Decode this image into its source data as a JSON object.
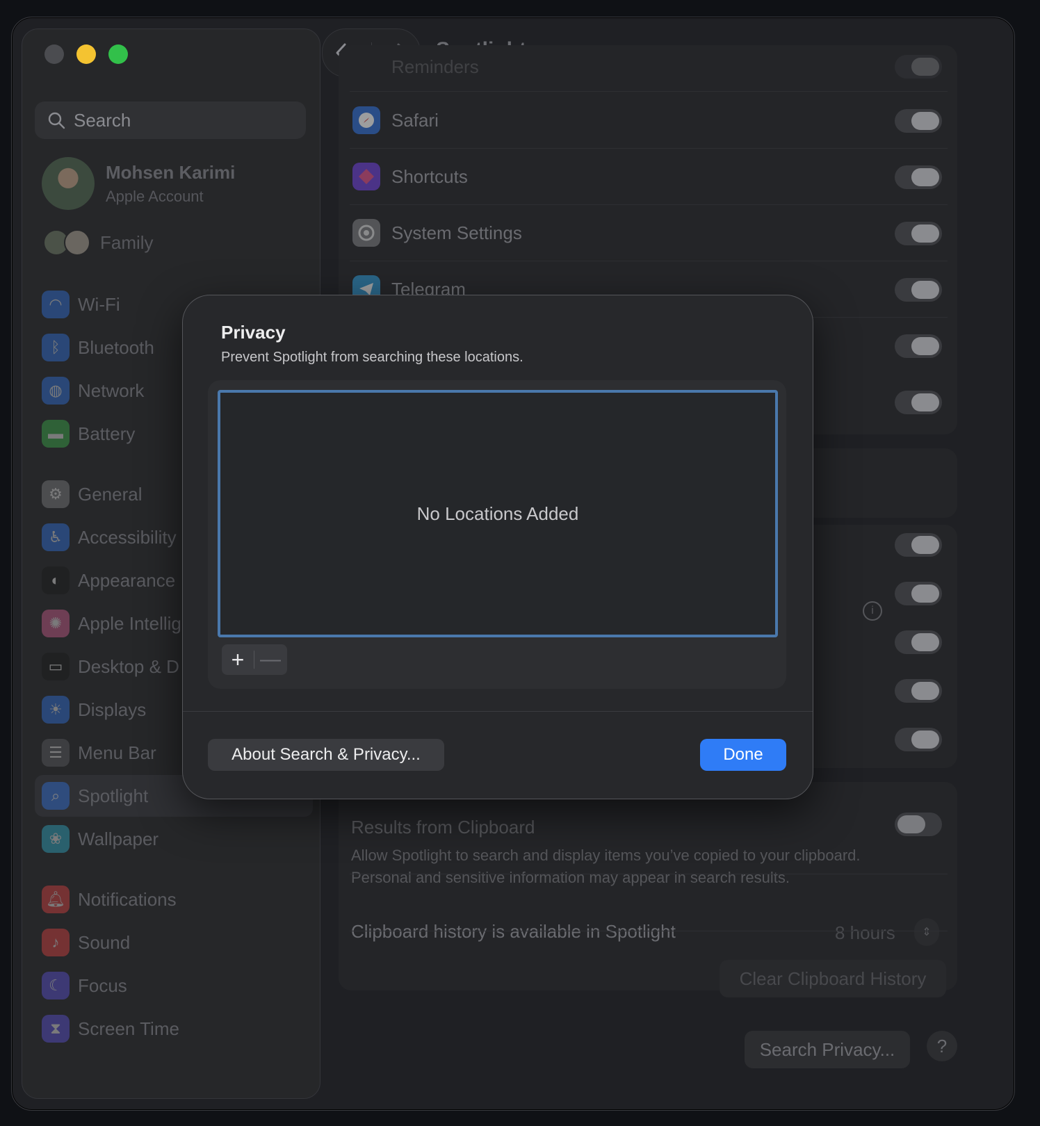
{
  "window": {
    "title": "Spotlight"
  },
  "sidebar": {
    "search_placeholder": "Search",
    "account": {
      "name": "Mohsen Karimi",
      "subtitle": "Apple Account"
    },
    "family_label": "Family",
    "items": [
      {
        "label": "Wi-Fi",
        "icon": "wifi-icon",
        "color": "#2f6fd6"
      },
      {
        "label": "Bluetooth",
        "icon": "bluetooth-icon",
        "color": "#2f6fd6"
      },
      {
        "label": "Network",
        "icon": "globe-icon",
        "color": "#2f6fd6"
      },
      {
        "label": "Battery",
        "icon": "battery-icon",
        "color": "#3aa84a"
      },
      {
        "label": "General",
        "icon": "gear-icon",
        "color": "#7a7b7f"
      },
      {
        "label": "Accessibility",
        "icon": "accessibility-icon",
        "color": "#2f6fd6"
      },
      {
        "label": "Appearance",
        "icon": "appearance-icon",
        "color": "#1a1a1a"
      },
      {
        "label": "Apple Intellig",
        "icon": "apple-intelligence-icon",
        "color": "#c65a8a"
      },
      {
        "label": "Desktop & D",
        "icon": "desktop-dock-icon",
        "color": "#1a1a1a"
      },
      {
        "label": "Displays",
        "icon": "displays-icon",
        "color": "#2f6fd6"
      },
      {
        "label": "Menu Bar",
        "icon": "menu-bar-icon",
        "color": "#5a5b5f"
      },
      {
        "label": "Spotlight",
        "icon": "spotlight-icon",
        "color": "#2f6fd6"
      },
      {
        "label": "Wallpaper",
        "icon": "wallpaper-icon",
        "color": "#2fa6c0"
      },
      {
        "label": "Notifications",
        "icon": "notifications-icon",
        "color": "#d64040"
      },
      {
        "label": "Sound",
        "icon": "sound-icon",
        "color": "#d64040"
      },
      {
        "label": "Focus",
        "icon": "focus-icon",
        "color": "#5a4fd0"
      },
      {
        "label": "Screen Time",
        "icon": "screen-time-icon",
        "color": "#5a4fd0"
      }
    ]
  },
  "main": {
    "partial_top_label": "Reminders",
    "apps": [
      {
        "label": "Safari",
        "icon": "safari-icon",
        "enabled": true
      },
      {
        "label": "Shortcuts",
        "icon": "shortcuts-icon",
        "enabled": true
      },
      {
        "label": "System Settings",
        "icon": "system-settings-icon",
        "enabled": true
      },
      {
        "label": "Telegram",
        "icon": "telegram-icon",
        "enabled": true
      }
    ],
    "clipboard": {
      "title": "Results from Clipboard",
      "description": "Allow Spotlight to search and display items you’ve copied to your clipboard. Personal and sensitive information may appear in search results.",
      "history_label": "Clipboard history is available in Spotlight",
      "history_value": "8 hours",
      "clear_button": "Clear Clipboard History"
    },
    "search_privacy_button": "Search Privacy...",
    "help_button": "?"
  },
  "dialog": {
    "title": "Privacy",
    "subtitle": "Prevent Spotlight from searching these locations.",
    "empty_text": "No Locations Added",
    "add_label": "+",
    "remove_label": "—",
    "about_button": "About Search & Privacy...",
    "done_button": "Done",
    "accent_color": "#2f7cf6"
  }
}
